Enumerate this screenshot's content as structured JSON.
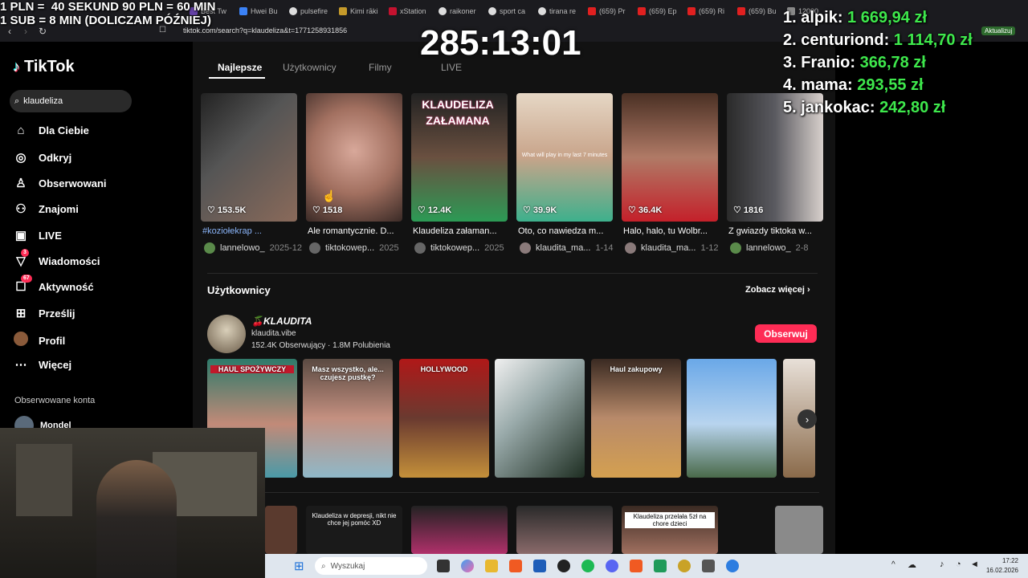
{
  "browser": {
    "tabs": [
      "Best Tw",
      "Hwei Bu",
      "pulsefire",
      "Kimi rāki",
      "xStation",
      "raikoner",
      "sport ca",
      "tirana re",
      "(659) Pr",
      "(659) Ep",
      "(659) Ri",
      "(659) Bu",
      "12000"
    ],
    "url": "tiktok.com/search?q=klaudeliza&t=1771258931856",
    "update_label": "Aktualizuj"
  },
  "stream_overlay": {
    "rates_line1": "1 PLN =  40 SEKUND 90 PLN = 60 MIN",
    "rates_line2": "1 SUB = 8 MIN (DOLICZAM PÓŹNIEJ)",
    "timer": "285:13:01",
    "leaderboard": [
      {
        "name": "1. alpik: ",
        "amount": "1 669,94 zł"
      },
      {
        "name": "2. centuriond: ",
        "amount": "1 114,70 zł"
      },
      {
        "name": "3. Franio: ",
        "amount": "366,78 zł"
      },
      {
        "name": "4. mama: ",
        "amount": "293,55 zł"
      },
      {
        "name": "5. jankokac: ",
        "amount": "242,80 zł"
      }
    ]
  },
  "sidebar": {
    "logo": "TikTok",
    "search_value": "klaudeliza",
    "items": [
      {
        "label": "Dla Ciebie",
        "icon": "home-icon"
      },
      {
        "label": "Odkryj",
        "icon": "compass-icon"
      },
      {
        "label": "Obserwowani",
        "icon": "following-icon"
      },
      {
        "label": "Znajomi",
        "icon": "friends-icon"
      },
      {
        "label": "LIVE",
        "icon": "live-icon"
      },
      {
        "label": "Wiadomości",
        "icon": "messages-icon",
        "badge": "3"
      },
      {
        "label": "Aktywność",
        "icon": "activity-icon",
        "badge": "67"
      },
      {
        "label": "Prześlij",
        "icon": "upload-icon"
      },
      {
        "label": "Profil",
        "icon": "profile-icon"
      },
      {
        "label": "Więcej",
        "icon": "more-icon"
      }
    ],
    "followed_heading": "Obserwowane konta",
    "followed_user": "Mondel"
  },
  "main": {
    "tabs": [
      "Najlepsze",
      "Użytkownicy",
      "Filmy",
      "LIVE"
    ],
    "videos": [
      {
        "likes": "153.5K",
        "caption": "#koziołekrap ...",
        "author": "lannelowo_",
        "date": "2025-12"
      },
      {
        "likes": "1518",
        "caption": "Ale romantycznie. D...",
        "author": "tiktokowep...",
        "date": "2025"
      },
      {
        "likes": "12.4K",
        "caption": "Klaudeliza załaman...",
        "author": "tiktokowep...",
        "date": "2025",
        "overlay": "KLAUDELIZA ZAŁAMANA"
      },
      {
        "likes": "39.9K",
        "caption": "Oto, co nawiedza m...",
        "author": "klaudita_ma...",
        "date": "1-14",
        "overlay": "What will play in my last 7 minutes"
      },
      {
        "likes": "36.4K",
        "caption": "Halo, halo, tu Wolbr...",
        "author": "klaudita_ma...",
        "date": "1-12"
      },
      {
        "likes": "1816",
        "caption": "Z gwiazdy tiktoka w...",
        "author": "lannelowo_",
        "date": "2-8"
      }
    ],
    "users_heading": "Użytkownicy",
    "see_more": "Zobacz więcej",
    "user": {
      "name": "🍒KLAUDITA",
      "handle": "klaudita.vibe",
      "stats": "152.4K Obserwujący · 1.8M Polubienia",
      "follow_label": "Obserwuj"
    },
    "user_videos": [
      {
        "text": "HAUL SPOŻYWCZY"
      },
      {
        "text": "Masz wszystko, ale... czujesz pustkę?"
      },
      {
        "text": "HOLLYWOOD"
      },
      {
        "text": ""
      },
      {
        "text": "Haul zakupowy"
      },
      {
        "text": ""
      }
    ],
    "bottom_videos": [
      {
        "text": ""
      },
      {
        "text": "Klaudeliza w depresji, nikt nie chce jej pomóc XD"
      },
      {
        "text": ""
      },
      {
        "text": ""
      },
      {
        "text": "Klaudeliza przelała 5zł na chore dzieci"
      }
    ]
  },
  "taskbar": {
    "search_placeholder": "Wyszukaj",
    "time": "17:22",
    "date": "16.02.2026"
  }
}
